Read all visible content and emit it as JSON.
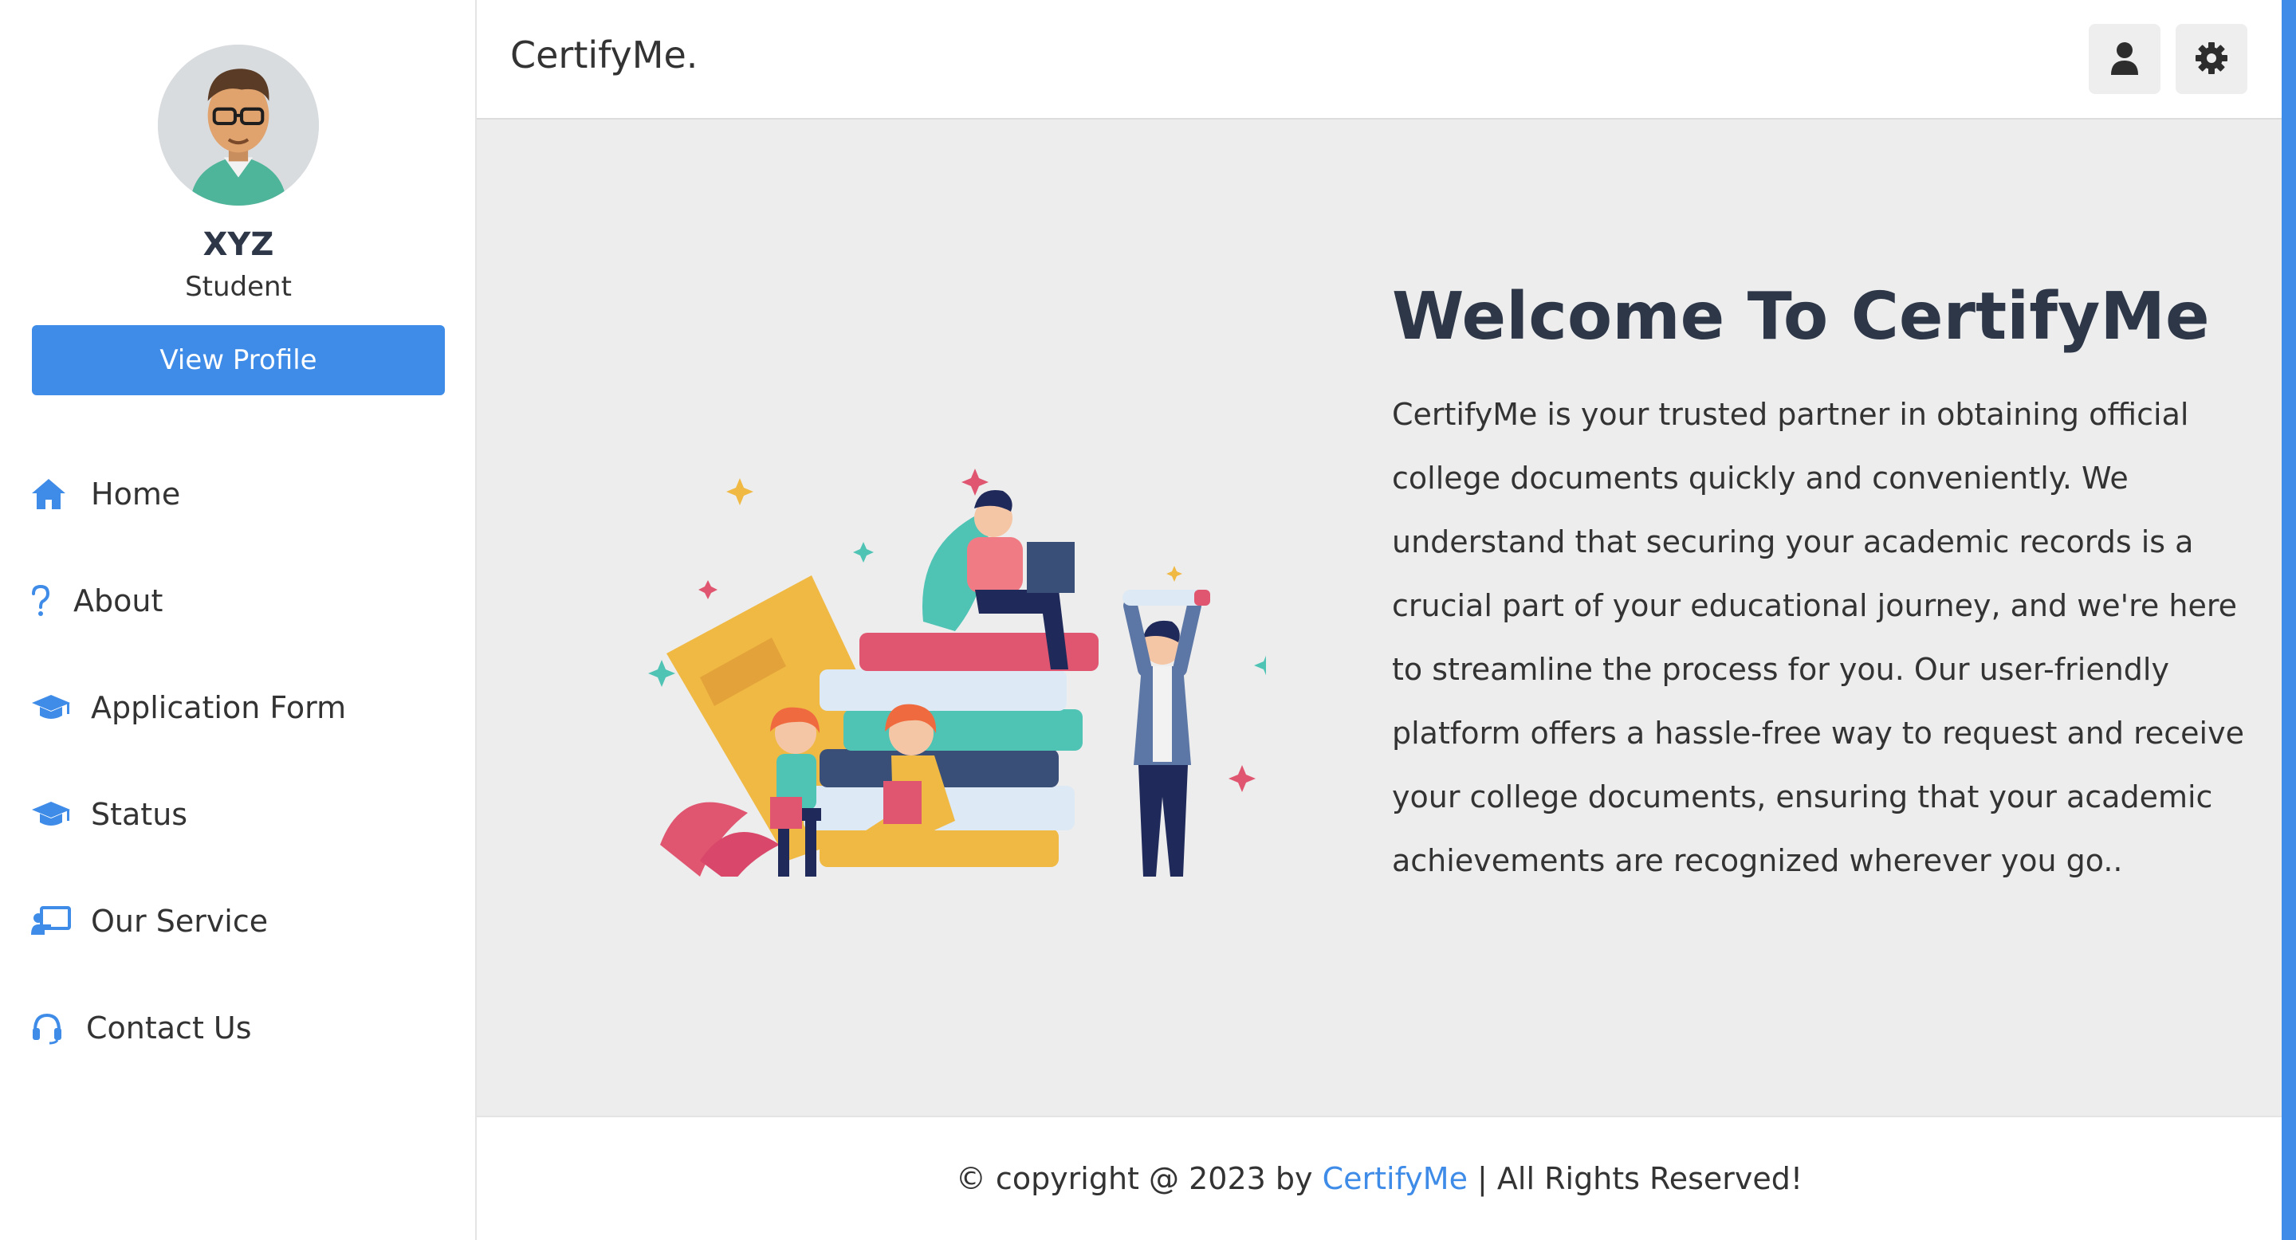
{
  "app": {
    "brand": "CertifyMe.",
    "accent_color": "#3f8ce8"
  },
  "sidebar": {
    "profile": {
      "name": "XYZ",
      "role": "Student",
      "button_label": "View Profile"
    },
    "items": [
      {
        "label": "Home",
        "icon": "home-icon"
      },
      {
        "label": "About",
        "icon": "question-icon"
      },
      {
        "label": "Application Form",
        "icon": "graduation-cap-icon"
      },
      {
        "label": "Status",
        "icon": "graduation-cap-icon"
      },
      {
        "label": "Our Service",
        "icon": "presentation-icon"
      },
      {
        "label": "Contact Us",
        "icon": "headset-icon"
      }
    ]
  },
  "header": {
    "buttons": [
      {
        "icon": "user-icon"
      },
      {
        "icon": "gear-icon"
      }
    ]
  },
  "main": {
    "title": "Welcome To CertifyMe",
    "description": "CertifyMe is your trusted partner in obtaining official college documents quickly and conveniently. We understand that securing your academic records is a crucial part of your educational journey, and we're here to streamline the process for you. Our user-friendly platform offers a hassle-free way to request and receive your college documents, ensuring that your academic achievements are recognized wherever you go.."
  },
  "footer": {
    "prefix": "© copyright @ 2023 by ",
    "link": "CertifyMe",
    "suffix": " | All Rights Reserved!"
  }
}
